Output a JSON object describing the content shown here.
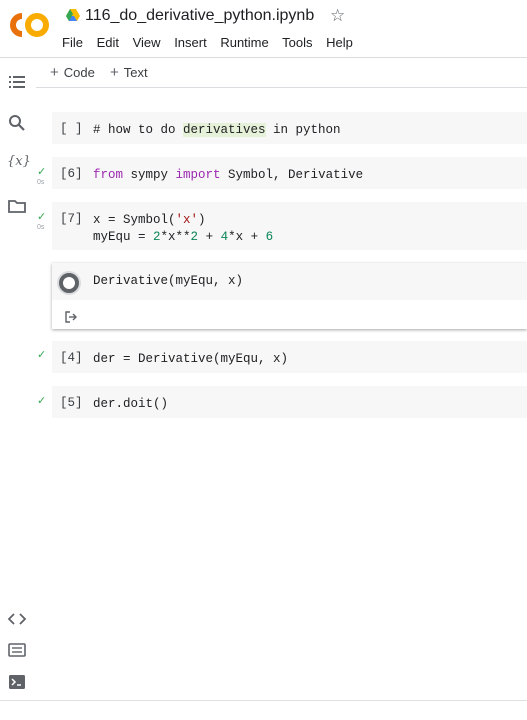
{
  "header": {
    "logo_text": "CO",
    "notebook_title": "116_do_derivative_python.ipynb",
    "menu": [
      "File",
      "Edit",
      "View",
      "Insert",
      "Runtime",
      "Tools",
      "Help"
    ]
  },
  "toolbar": {
    "add_code_label": "Code",
    "add_text_label": "Text"
  },
  "rail": {
    "icons": [
      "table-of-contents-icon",
      "search-icon",
      "variables-icon",
      "files-icon",
      "code-snippets-icon",
      "command-palette-icon",
      "terminal-icon"
    ],
    "variables_label": "{x}"
  },
  "cells": [
    {
      "prompt": "[ ]",
      "status": "",
      "time": "",
      "code": "# how to do derivatives in python"
    },
    {
      "prompt": "[6]",
      "status": "✓",
      "time": "0s",
      "code": "from sympy import Symbol, Derivative"
    },
    {
      "prompt": "[7]",
      "status": "✓",
      "time": "0s",
      "code_line1": "x = Symbol('x')",
      "code_line2": "myEqu = 2*x**2 + 4*x + 6"
    },
    {
      "prompt": "",
      "status": "",
      "time": "",
      "code": "Derivative(myEqu, x)"
    },
    {
      "prompt": "[4]",
      "status": "✓",
      "time": "",
      "code": "der = Derivative(myEqu, x)"
    },
    {
      "prompt": "[5]",
      "status": "✓",
      "time": "",
      "code": "der.doit()"
    }
  ],
  "colors": {
    "accent_check": "#34a853",
    "keyword": "#9c27b0",
    "string": "#a31515",
    "number": "#098658",
    "comment": "#008000",
    "logo_orange": "#f9ab00",
    "logo_dark_orange": "#e8710a"
  }
}
